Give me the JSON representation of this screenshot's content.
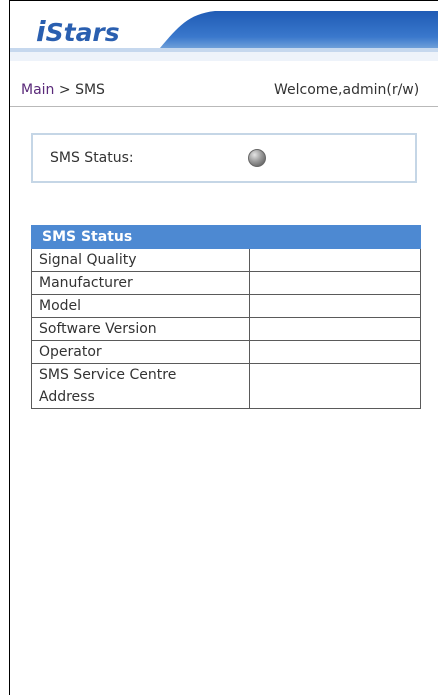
{
  "header": {
    "logo_prefix": "i",
    "logo_rest": "Stars"
  },
  "breadcrumb": {
    "main_link": "Main",
    "separator": " > ",
    "current": "SMS"
  },
  "welcome": "Welcome,admin(r/w)",
  "sms_status": {
    "label": "SMS Status:",
    "led_state": "grey"
  },
  "table": {
    "header": "SMS Status",
    "rows": [
      {
        "key": "Signal Quality",
        "value": ""
      },
      {
        "key": "Manufacturer",
        "value": ""
      },
      {
        "key": "Model",
        "value": ""
      },
      {
        "key": "Software Version",
        "value": ""
      },
      {
        "key": "Operator",
        "value": ""
      },
      {
        "key": "SMS Service Centre Address",
        "value": ""
      }
    ]
  },
  "colors": {
    "accent": "#4d89d2",
    "logo": "#2a5fb0",
    "header_band": "#2b67bb"
  }
}
